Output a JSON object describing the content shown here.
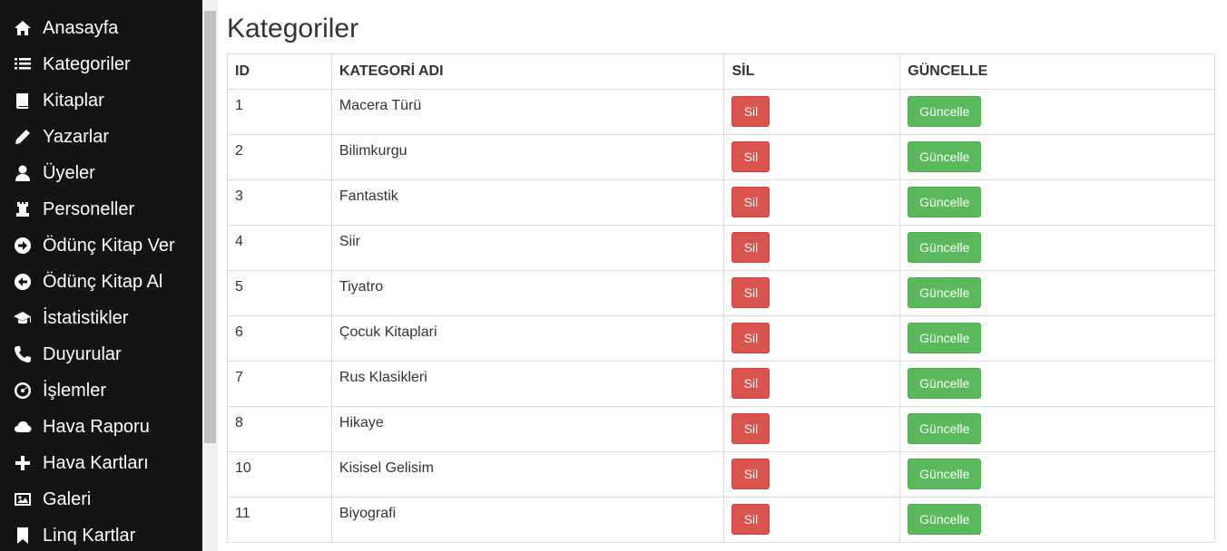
{
  "sidebar": {
    "items": [
      {
        "label": "Anasayfa",
        "icon": "home-icon"
      },
      {
        "label": "Kategoriler",
        "icon": "list-icon"
      },
      {
        "label": "Kitaplar",
        "icon": "book-icon"
      },
      {
        "label": "Yazarlar",
        "icon": "pencil-icon"
      },
      {
        "label": "Üyeler",
        "icon": "user-icon"
      },
      {
        "label": "Personeller",
        "icon": "tower-icon"
      },
      {
        "label": "Ödünç Kitap Ver",
        "icon": "circle-arrow-right-icon"
      },
      {
        "label": "Ödünç Kitap Al",
        "icon": "circle-arrow-left-icon"
      },
      {
        "label": "İstatistikler",
        "icon": "education-icon"
      },
      {
        "label": "Duyurular",
        "icon": "phone-icon"
      },
      {
        "label": "İşlemler",
        "icon": "dashboard-icon"
      },
      {
        "label": "Hava Raporu",
        "icon": "cloud-icon"
      },
      {
        "label": "Hava Kartları",
        "icon": "plus-icon"
      },
      {
        "label": "Galeri",
        "icon": "picture-icon"
      },
      {
        "label": "Linq Kartlar",
        "icon": "bookmark-icon"
      }
    ]
  },
  "main": {
    "title": "Kategoriler",
    "table": {
      "headers": [
        "ID",
        "KATEGORİ ADI",
        "SİL",
        "GÜNCELLE"
      ],
      "delete_label": "Sil",
      "update_label": "Güncelle",
      "rows": [
        {
          "id": "1",
          "name": "Macera Türü"
        },
        {
          "id": "2",
          "name": "Bilimkurgu"
        },
        {
          "id": "3",
          "name": "Fantastik"
        },
        {
          "id": "4",
          "name": "Siir"
        },
        {
          "id": "5",
          "name": "Tiyatro"
        },
        {
          "id": "6",
          "name": "Çocuk Kitaplari"
        },
        {
          "id": "7",
          "name": "Rus Klasikleri"
        },
        {
          "id": "8",
          "name": "Hikaye"
        },
        {
          "id": "10",
          "name": "Kisisel Gelisim"
        },
        {
          "id": "11",
          "name": "Biyografi"
        }
      ]
    }
  },
  "colors": {
    "sidebar_bg": "#141414",
    "danger": "#d9534f",
    "success": "#5cb85c"
  }
}
